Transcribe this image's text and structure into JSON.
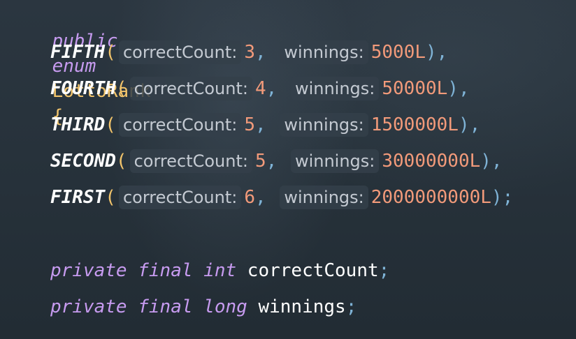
{
  "code": {
    "declaration": {
      "kw_public": "public",
      "kw_enum": "enum",
      "name": "LottoRank",
      "brace": "{"
    },
    "entries": [
      {
        "name": "FIFTH",
        "hint1": "correctCount:",
        "count": "3",
        "hint2": "winnings:",
        "winnings": "5000L",
        "end": "),"
      },
      {
        "name": "FOURTH",
        "hint1": "correctCount:",
        "count": "4",
        "hint2": "winnings:",
        "winnings": "50000L",
        "end": "),"
      },
      {
        "name": "THIRD",
        "hint1": "correctCount:",
        "count": "5",
        "hint2": "winnings:",
        "winnings": "1500000L",
        "end": "),"
      },
      {
        "name": "SECOND",
        "hint1": "correctCount:",
        "count": "5",
        "hint2": "winnings:",
        "winnings": "30000000L",
        "end": "),"
      },
      {
        "name": "FIRST",
        "hint1": "correctCount:",
        "count": "6",
        "hint2": "winnings:",
        "winnings": "2000000000L",
        "end": ");"
      }
    ],
    "fields": [
      {
        "kw_private": "private",
        "kw_final": "final",
        "type": "int",
        "name": "correctCount",
        "semi": ";"
      },
      {
        "kw_private": "private",
        "kw_final": "final",
        "type": "long",
        "name": "winnings",
        "semi": ";"
      }
    ],
    "tokens": {
      "open_paren": "(",
      "comma": ","
    }
  },
  "colors": {
    "keyword": "#c79bf0",
    "type_name": "#f2c46b",
    "constant": "#ffffff",
    "number": "#f29a7a",
    "punctuation": "#7fb3d6",
    "hint_bg": "#34404a",
    "hint_text": "#c4cad2"
  }
}
